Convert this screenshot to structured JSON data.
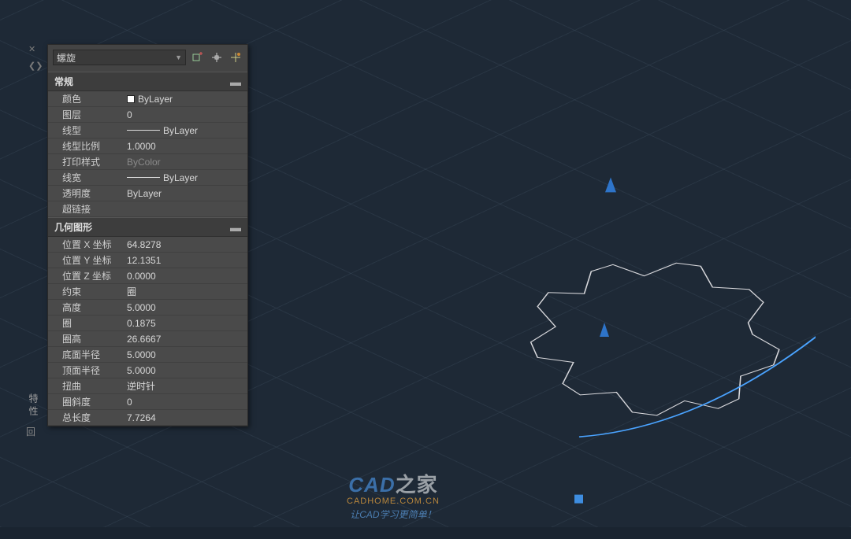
{
  "side_label": "特性",
  "bottom_icon": "回",
  "object_type": "螺旋",
  "sections": {
    "general": {
      "title": "常规",
      "rows": [
        {
          "label": "颜色",
          "value": "ByLayer",
          "swatch": true
        },
        {
          "label": "图层",
          "value": "0"
        },
        {
          "label": "线型",
          "value": "ByLayer",
          "line": true
        },
        {
          "label": "线型比例",
          "value": "1.0000"
        },
        {
          "label": "打印样式",
          "value": "ByColor",
          "muted": true
        },
        {
          "label": "线宽",
          "value": "ByLayer",
          "line": true
        },
        {
          "label": "透明度",
          "value": "ByLayer"
        },
        {
          "label": "超链接",
          "value": ""
        }
      ]
    },
    "geometry": {
      "title": "几何图形",
      "rows": [
        {
          "label": "位置 X 坐标",
          "value": "64.8278"
        },
        {
          "label": "位置 Y 坐标",
          "value": "12.1351"
        },
        {
          "label": "位置 Z 坐标",
          "value": "0.0000"
        },
        {
          "label": "约束",
          "value": "圈"
        },
        {
          "label": "高度",
          "value": "5.0000"
        },
        {
          "label": "圈",
          "value": "0.1875"
        },
        {
          "label": "圈高",
          "value": "26.6667"
        },
        {
          "label": "底面半径",
          "value": "5.0000"
        },
        {
          "label": "顶面半径",
          "value": "5.0000"
        },
        {
          "label": "扭曲",
          "value": "逆时针"
        },
        {
          "label": "圈斜度",
          "value": "0"
        },
        {
          "label": "总长度",
          "value": "7.7264"
        }
      ]
    }
  },
  "watermark": {
    "l1a": "CAD",
    "l1b": "之家",
    "l2": "CADHOME.COM.CN",
    "l3": "让CAD学习更简单！"
  }
}
